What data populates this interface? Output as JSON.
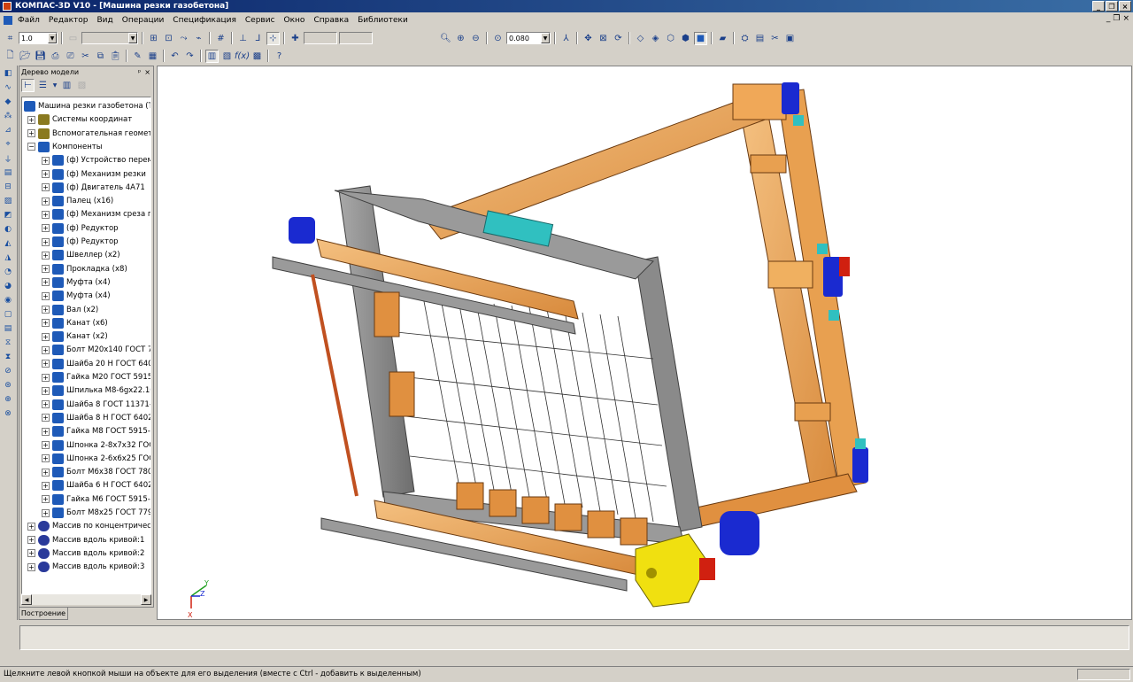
{
  "window": {
    "title": "КОМПАС-3D V10 - [Машина резки газобетона]",
    "controls": [
      "_",
      "❐",
      "×"
    ]
  },
  "menu": {
    "items": [
      "Файл",
      "Редактор",
      "Вид",
      "Операции",
      "Спецификация",
      "Сервис",
      "Окно",
      "Справка",
      "Библиотеки"
    ],
    "mdi_controls": [
      "_",
      "❐",
      "×"
    ]
  },
  "toolbar": {
    "step_value": "1.0",
    "zoom_value": "0.080"
  },
  "tree": {
    "panel_title": "Дерево модели",
    "panel_controls": [
      "ᵖ",
      "×"
    ],
    "tab_label": "Построение",
    "root": "Машина резки газобетона (Тел-",
    "groups": [
      {
        "label": "Системы координат",
        "icon": "coord-system-icon"
      },
      {
        "label": "Вспомогательная геометрия",
        "icon": "aux-geometry-icon"
      },
      {
        "label": "Компоненты",
        "icon": "components-icon"
      }
    ],
    "components": [
      "(ф) Устройство переме",
      "(ф) Механизм резки",
      "(ф) Двигатель 4А71",
      "Палец (x16)",
      "(ф) Механизм среза гор",
      "(ф) Редуктор",
      "(ф) Редуктор",
      "Швеллер (x2)",
      "Прокладка (x8)",
      "Муфта (x4)",
      "Муфта (x4)",
      "Вал (x2)",
      "Канат (x6)",
      "Канат (x2)",
      "Болт M20x140 ГОСТ 78",
      "Шайба 20 Н ГОСТ 6402",
      "Гайка M20 ГОСТ 5915-",
      "Шпилька M8-6gx22.10",
      "Шайба 8 ГОСТ 11371-7",
      "Шайба 8 Н ГОСТ 6402-",
      "Гайка M8 ГОСТ 5915-7",
      "Шпонка 2-8x7x32 ГОСТ",
      "Шпонка 2-6x6x25 ГОС",
      "Болт M6x38 ГОСТ 7805",
      "Шайба 6 Н ГОСТ 6402-",
      "Гайка M6 ГОСТ 5915-7",
      "Болт M8x25 ГОСТ 7798"
    ],
    "arrays": [
      "Массив по концентрическо",
      "Массив вдоль кривой:1",
      "Массив вдоль кривой:2",
      "Массив вдоль кривой:3"
    ]
  },
  "axes": {
    "x": "X",
    "y": "Y",
    "z": "Z"
  },
  "status": {
    "hint": "Щелкните левой кнопкой мыши на объекте для его выделения (вместе с Ctrl - добавить к выделенным)"
  },
  "colors": {
    "wood": "#e8a050",
    "steel": "#8a8a8a",
    "motor": "#1a2ad0",
    "gearbox": "#f0e010",
    "accent_red": "#d02010",
    "cyan": "#30c0c0"
  }
}
